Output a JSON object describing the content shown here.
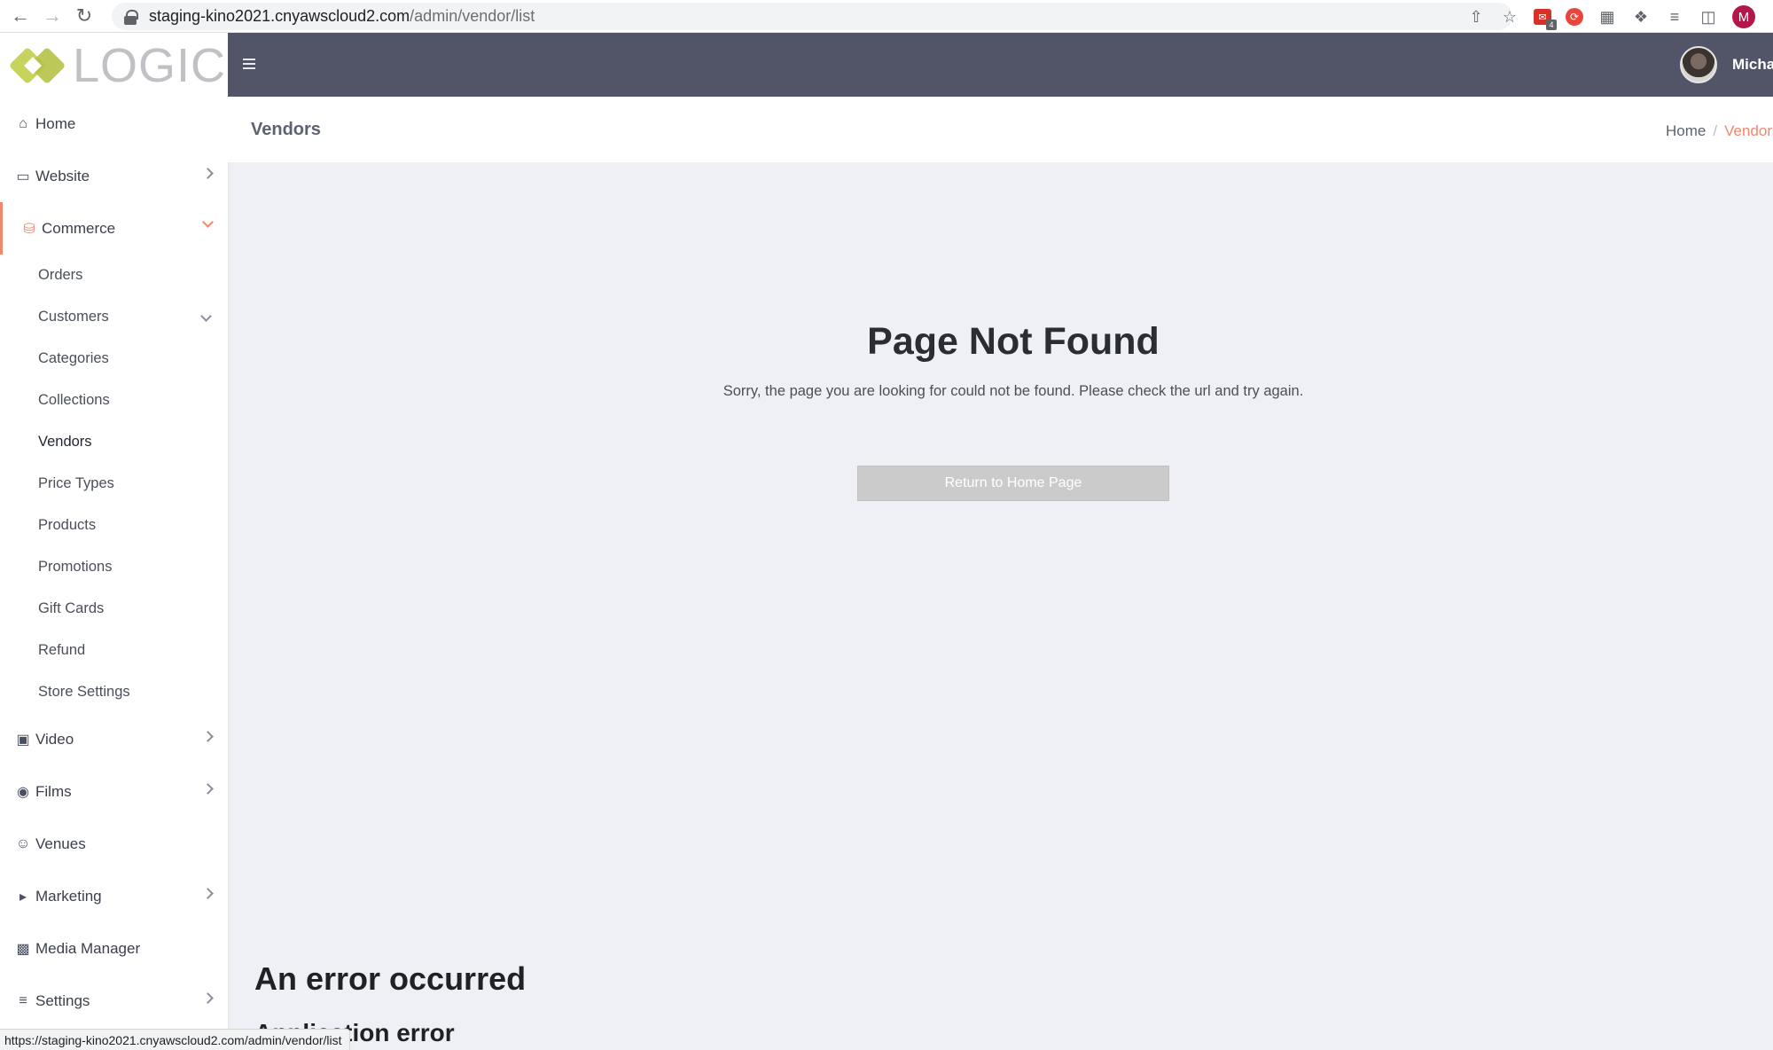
{
  "browser": {
    "url_host": "staging-kino2021.cnyawscloud2.com",
    "url_path": "/admin/vendor/list",
    "extension_badge": "4",
    "profile_initial": "M"
  },
  "sidebar": {
    "logo_text": "LOGIC",
    "items": [
      {
        "label": "Home",
        "icon": "home-icon"
      },
      {
        "label": "Website",
        "icon": "desktop-icon"
      },
      {
        "label": "Commerce",
        "icon": "basket-icon"
      },
      {
        "label": "Video",
        "icon": "film-icon"
      },
      {
        "label": "Films",
        "icon": "camera-icon"
      },
      {
        "label": "Venues",
        "icon": "masks-icon"
      },
      {
        "label": "Marketing",
        "icon": "megaphone-icon"
      },
      {
        "label": "Media Manager",
        "icon": "folder-plus-icon"
      },
      {
        "label": "Settings",
        "icon": "sliders-icon"
      }
    ],
    "commerce_sub": [
      {
        "label": "Orders"
      },
      {
        "label": "Customers"
      },
      {
        "label": "Categories"
      },
      {
        "label": "Collections"
      },
      {
        "label": "Vendors"
      },
      {
        "label": "Price Types"
      },
      {
        "label": "Products"
      },
      {
        "label": "Promotions"
      },
      {
        "label": "Gift Cards"
      },
      {
        "label": "Refund"
      },
      {
        "label": "Store Settings"
      }
    ]
  },
  "header": {
    "user_name": "Micha"
  },
  "page": {
    "title": "Vendors",
    "breadcrumb": [
      "Home",
      "Vendors"
    ]
  },
  "main": {
    "not_found_title": "Page Not Found",
    "not_found_text": "Sorry, the page you are looking for could not be found. Please check the url and try again.",
    "return_button": "Return to Home Page",
    "error_title": "An error occurred",
    "error_subtitle": "Application error"
  },
  "status_bar": {
    "link_url": "https://staging-kino2021.cnyawscloud2.com/admin/vendor/list"
  },
  "colors": {
    "accent": "#f2866b",
    "topbar": "#525568",
    "logo_green": "#c7d35c"
  }
}
